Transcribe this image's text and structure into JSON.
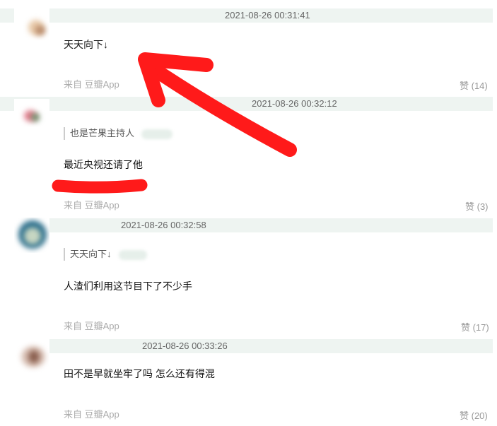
{
  "comments": [
    {
      "timestamp": "2021-08-26 00:31:41",
      "quote": "",
      "text": "天天向下↓",
      "source": "来自 豆瓣App",
      "likes": "赞 (14)"
    },
    {
      "timestamp": "2021-08-26 00:32:12",
      "quote": "也是芒果主持人",
      "text": "最近央视还请了他",
      "source": "来自 豆瓣App",
      "likes": "赞 (3)"
    },
    {
      "timestamp": "2021-08-26 00:32:58",
      "quote": "天天向下↓",
      "text": "人渣们利用这节目下了不少手",
      "source": "来自 豆瓣App",
      "likes": "赞 (17)"
    },
    {
      "timestamp": "2021-08-26 00:33:26",
      "quote": "",
      "text": "田不是早就坐牢了吗 怎么还有得混",
      "source": "来自 豆瓣App",
      "likes": "赞 (20)"
    }
  ],
  "colors": {
    "header_bg": "#eef4f1",
    "annotation": "#ff1a1a",
    "timestamp_text": "#666666",
    "source_text": "#aaaaaa"
  },
  "icons": [
    "avatar-image",
    "red-arrow-annotation",
    "red-underline-annotation"
  ]
}
